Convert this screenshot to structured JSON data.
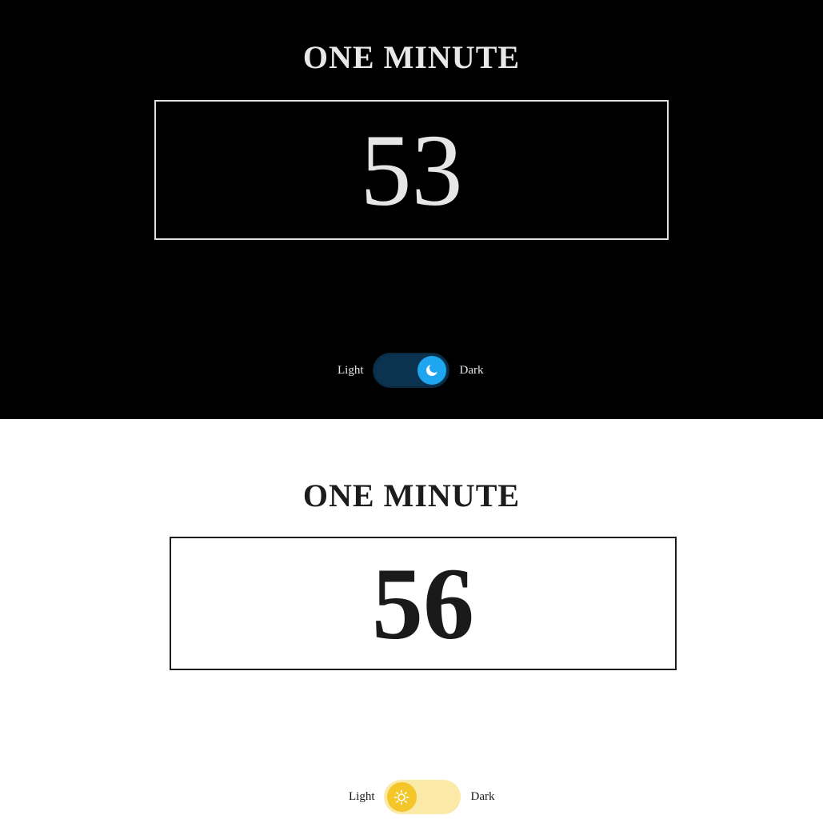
{
  "dark_panel": {
    "title": "ONE MINUTE",
    "counter": "53",
    "toggle": {
      "left_label": "Light",
      "right_label": "Dark",
      "state": "dark",
      "icon": "moon-icon"
    }
  },
  "light_panel": {
    "title": "ONE MINUTE",
    "counter": "56",
    "toggle": {
      "left_label": "Light",
      "right_label": "Dark",
      "state": "light",
      "icon": "sun-icon"
    }
  },
  "colors": {
    "dark_bg": "#000000",
    "light_bg": "#ffffff",
    "dark_switch_track": "#0b3350",
    "dark_switch_knob": "#1fa6f0",
    "light_switch_track": "#fbe9a8",
    "light_switch_knob": "#f4c62a"
  }
}
